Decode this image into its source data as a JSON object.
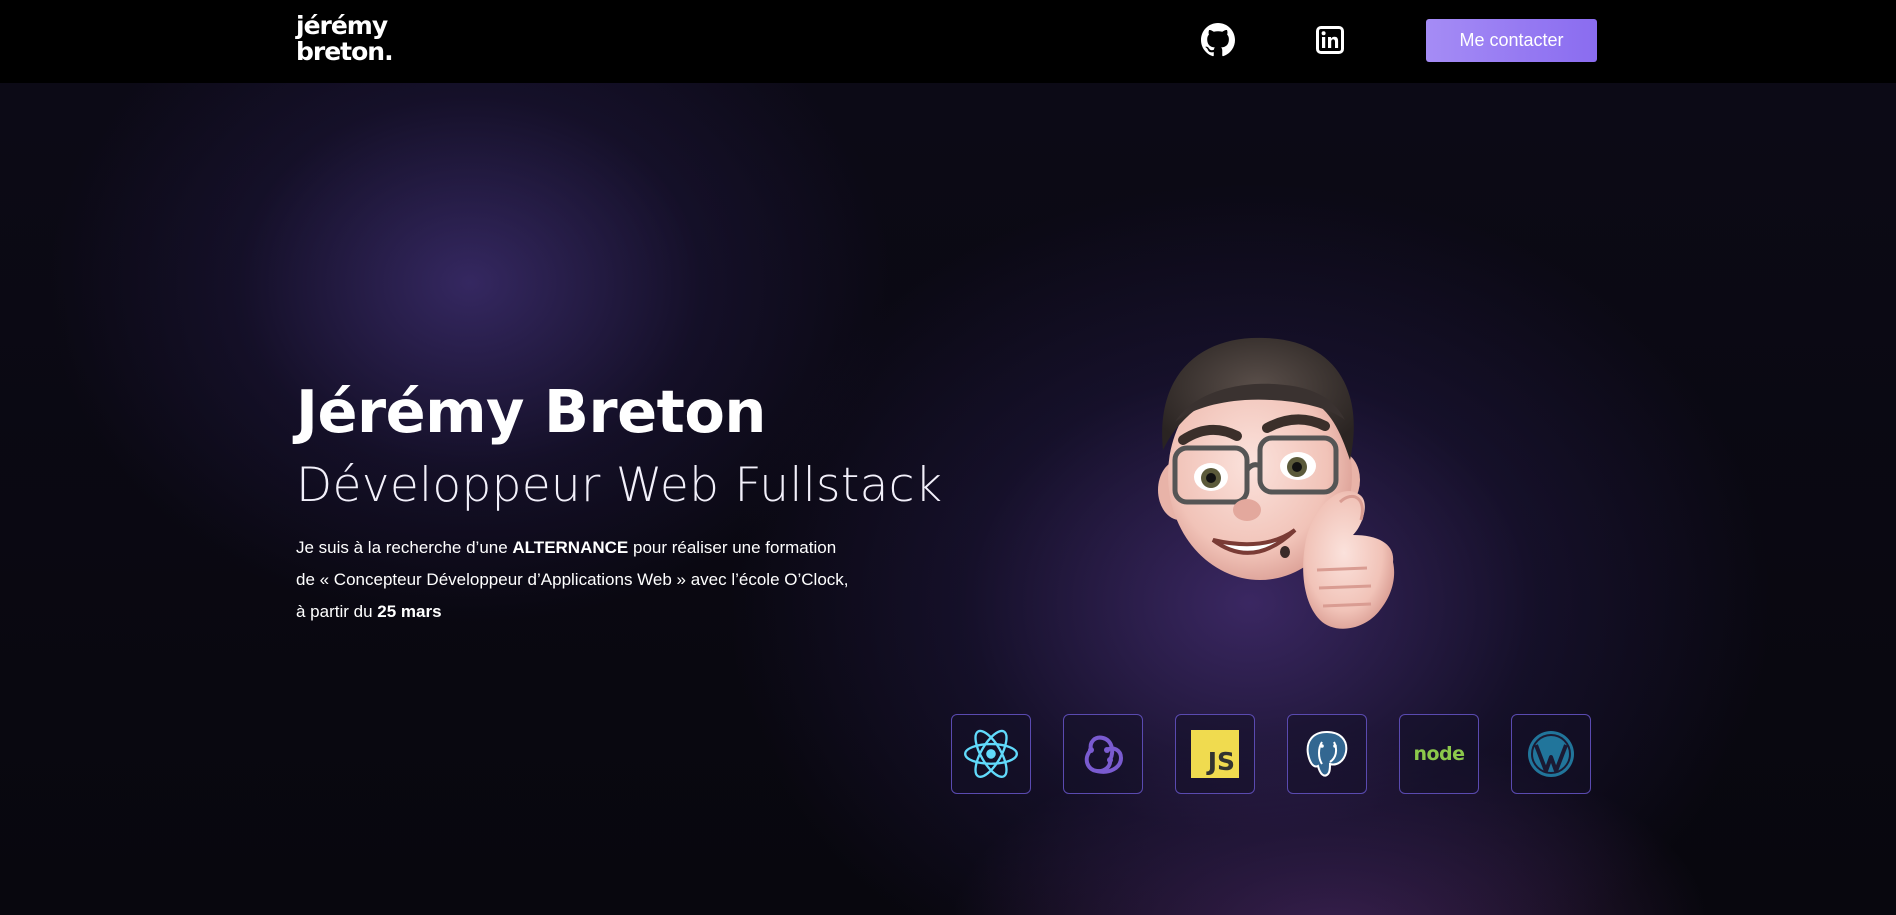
{
  "navbar": {
    "logo_line1": "jérémy",
    "logo_line2": "breton.",
    "icons": [
      "github-icon",
      "linkedin-icon"
    ],
    "contact_label": "Me contacter"
  },
  "hero": {
    "name": "Jérémy Breton",
    "job_title": "Développeur Web Fullstack",
    "bio": {
      "part1": "Je suis à la recherche d’une ",
      "highlight1": "ALTERNANCE",
      "part2": " pour réaliser une formation de « Concepteur Développeur d’Applications Web » avec l’école O’Clock, à partir du ",
      "highlight2": "25 mars"
    },
    "avatar_icon": "memoji-thumbs-up-avatar"
  },
  "tech_stack": [
    {
      "icon": "react-icon"
    },
    {
      "icon": "redux-icon"
    },
    {
      "icon": "javascript-icon",
      "text": "JS"
    },
    {
      "icon": "postgresql-icon"
    },
    {
      "icon": "nodejs-icon",
      "text": "node"
    },
    {
      "icon": "wordpress-icon"
    }
  ],
  "colors": {
    "accent": "#9b7ff3",
    "tile_border": "#5a4ab0",
    "background": "#07060d"
  }
}
